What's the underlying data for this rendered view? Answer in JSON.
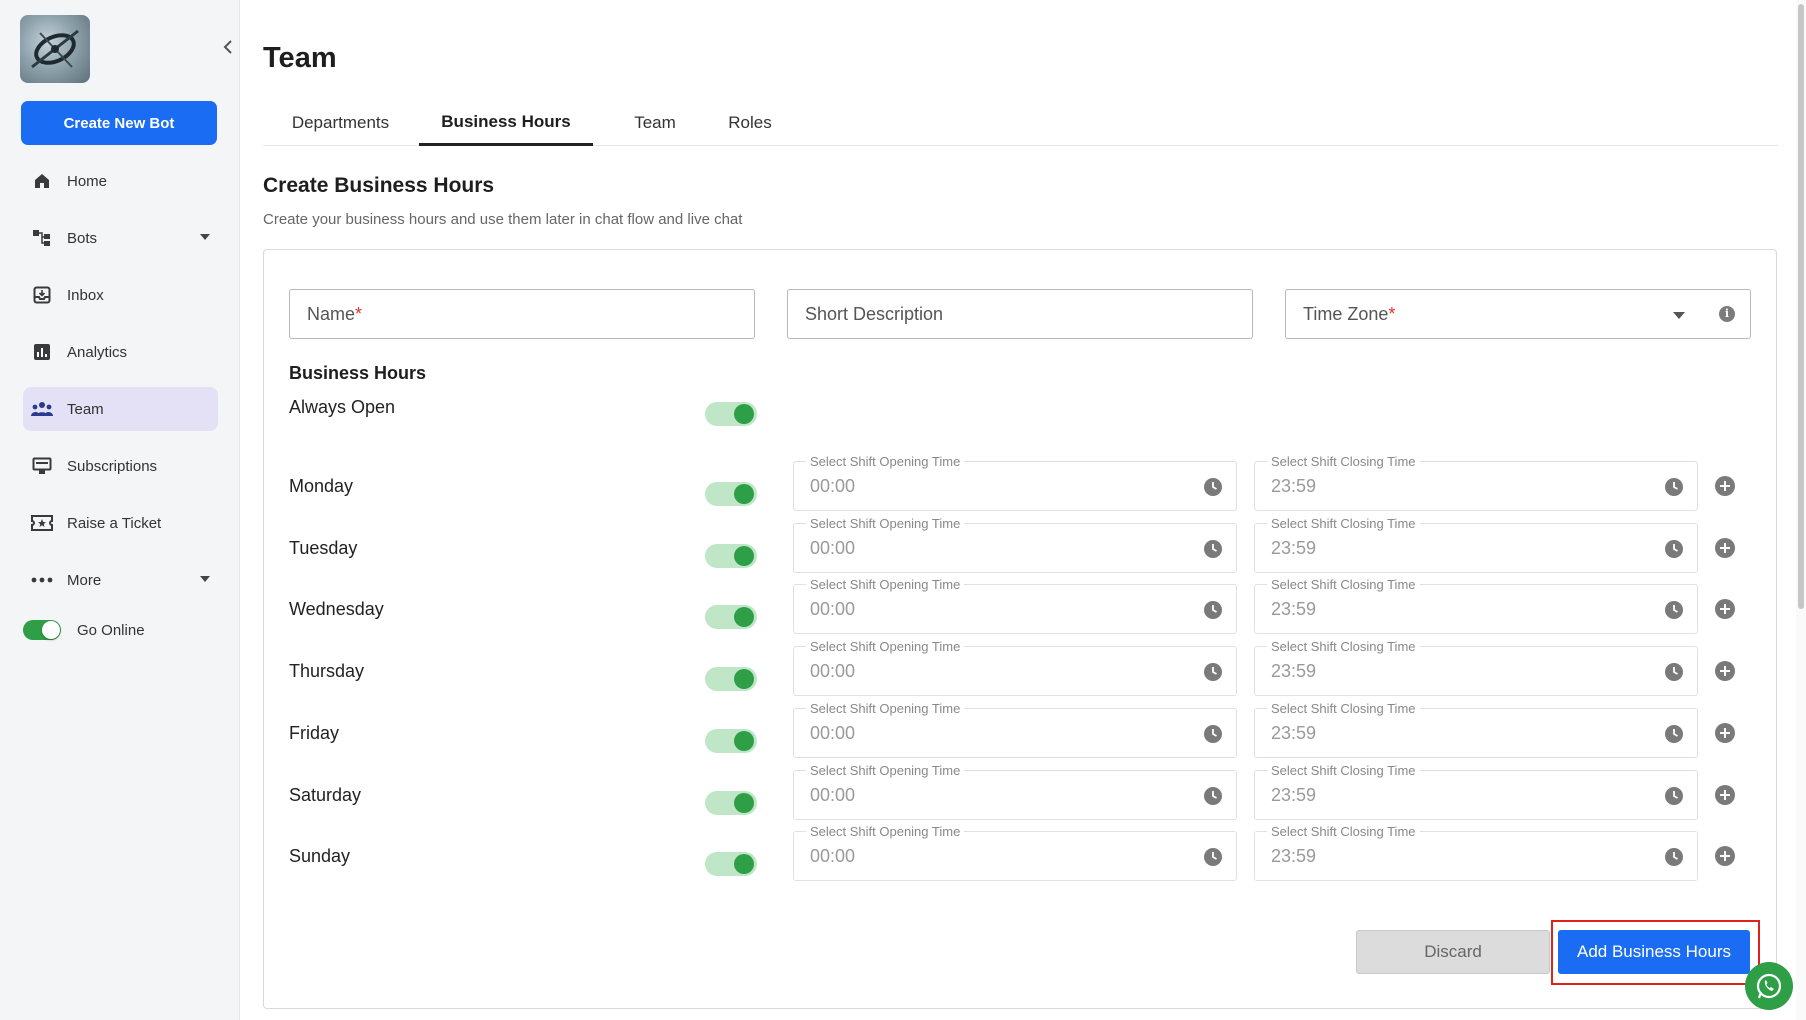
{
  "sidebar": {
    "create_bot_label": "Create New Bot",
    "items": [
      {
        "label": "Home",
        "icon": "home-icon"
      },
      {
        "label": "Bots",
        "icon": "bots-icon"
      },
      {
        "label": "Inbox",
        "icon": "inbox-icon"
      },
      {
        "label": "Analytics",
        "icon": "analytics-icon"
      },
      {
        "label": "Team",
        "icon": "team-icon"
      },
      {
        "label": "Subscriptions",
        "icon": "subscriptions-icon"
      },
      {
        "label": "Raise a Ticket",
        "icon": "ticket-icon"
      },
      {
        "label": "More",
        "icon": "more-icon"
      }
    ],
    "go_online_label": "Go Online"
  },
  "header": {
    "title": "Team",
    "tabs": [
      "Departments",
      "Business Hours",
      "Team",
      "Roles"
    ]
  },
  "form": {
    "section_title": "Create Business Hours",
    "section_subtitle": "Create your business hours and use them later in chat flow and live chat",
    "name_placeholder": "Name",
    "short_description_placeholder": "Short Description",
    "timezone_placeholder": "Time Zone",
    "required_mark": "*",
    "business_hours_title": "Business Hours",
    "always_open_label": "Always Open",
    "opening_label": "Select Shift Opening Time",
    "closing_label": "Select Shift Closing Time",
    "days": [
      {
        "name": "Monday",
        "open": "00:00",
        "close": "23:59"
      },
      {
        "name": "Tuesday",
        "open": "00:00",
        "close": "23:59"
      },
      {
        "name": "Wednesday",
        "open": "00:00",
        "close": "23:59"
      },
      {
        "name": "Thursday",
        "open": "00:00",
        "close": "23:59"
      },
      {
        "name": "Friday",
        "open": "00:00",
        "close": "23:59"
      },
      {
        "name": "Saturday",
        "open": "00:00",
        "close": "23:59"
      },
      {
        "name": "Sunday",
        "open": "00:00",
        "close": "23:59"
      }
    ],
    "discard_label": "Discard",
    "add_label": "Add Business Hours"
  },
  "colors": {
    "primary": "#1a6cf2",
    "toggle_on": "#2e9e47",
    "active_nav": "#e4e1f6",
    "highlight": "#e0211c"
  }
}
